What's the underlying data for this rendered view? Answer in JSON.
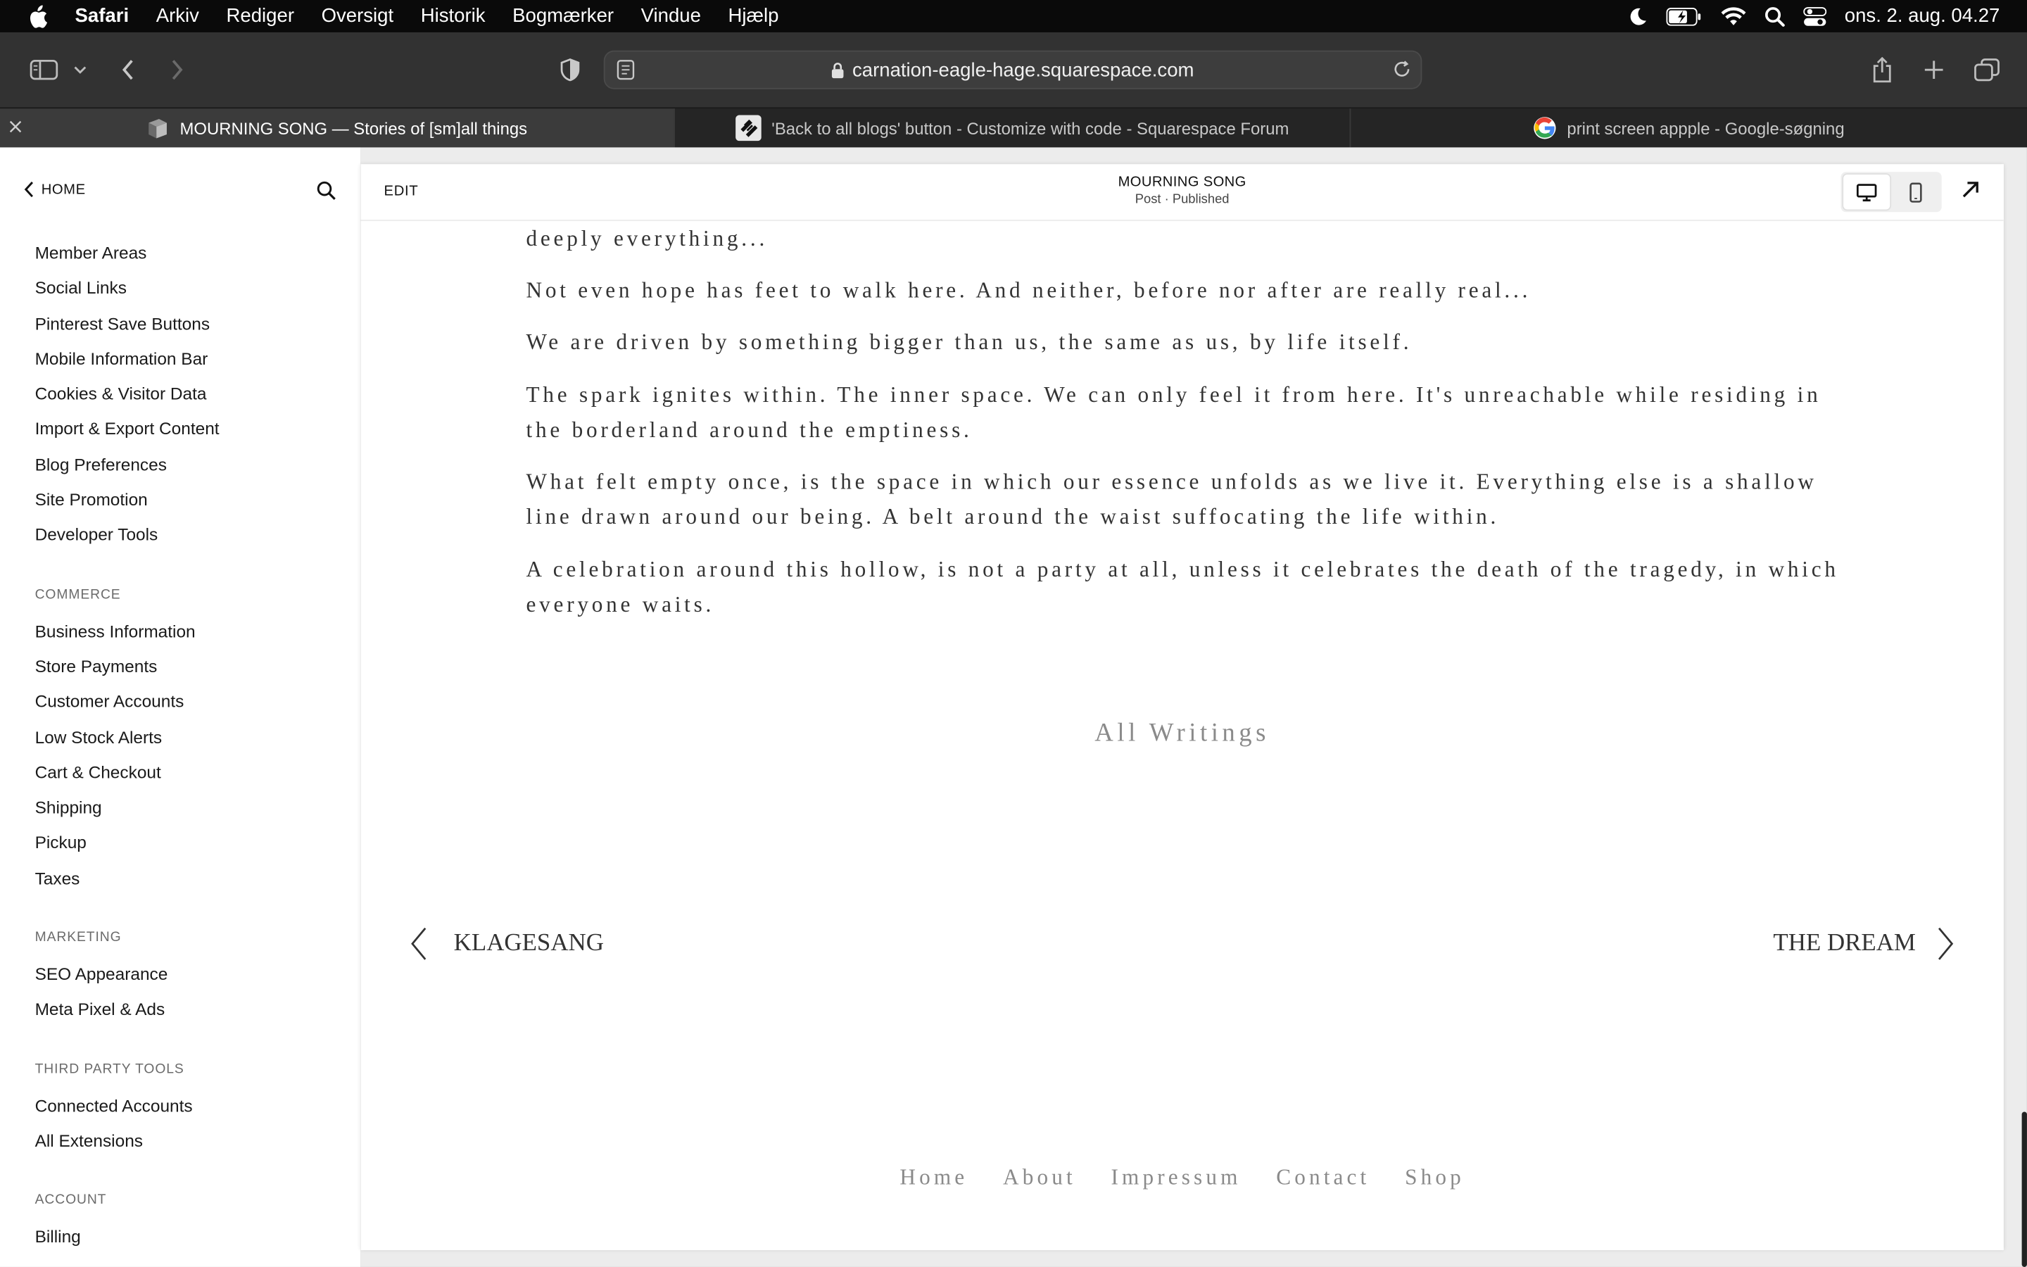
{
  "menubar": {
    "items": [
      "Safari",
      "Arkiv",
      "Rediger",
      "Oversigt",
      "Historik",
      "Bogmærker",
      "Vindue",
      "Hjælp"
    ],
    "clock": "ons. 2. aug. 04.27"
  },
  "toolbar": {
    "url": "carnation-eagle-hage.squarespace.com"
  },
  "tabs": [
    {
      "title": "MOURNING SONG — Stories of [sm]all things",
      "icon": "page-icon"
    },
    {
      "title": "'Back to all blogs' button - Customize with code - Squarespace Forum",
      "icon": "squarespace-icon"
    },
    {
      "title": "print screen appple - Google-søgning",
      "icon": "google-icon"
    }
  ],
  "sidebar": {
    "home_label": "HOME",
    "group1": [
      "Member Areas",
      "Social Links",
      "Pinterest Save Buttons",
      "Mobile Information Bar",
      "Cookies & Visitor Data",
      "Import & Export Content",
      "Blog Preferences",
      "Site Promotion",
      "Developer Tools"
    ],
    "commerce_heading": "COMMERCE",
    "commerce": [
      "Business Information",
      "Store Payments",
      "Customer Accounts",
      "Low Stock Alerts",
      "Cart & Checkout",
      "Shipping",
      "Pickup",
      "Taxes"
    ],
    "marketing_heading": "MARKETING",
    "marketing": [
      "SEO Appearance",
      "Meta Pixel & Ads"
    ],
    "third_party_heading": "THIRD PARTY TOOLS",
    "third_party": [
      "Connected Accounts",
      "All Extensions"
    ],
    "account_heading": "ACCOUNT",
    "account": [
      "Billing"
    ]
  },
  "editor": {
    "edit_label": "EDIT",
    "post_title": "MOURNING SONG",
    "post_status": "Post · Published"
  },
  "post": {
    "paragraphs": [
      "deeply everything...",
      "Not even hope has feet to walk here. And neither, before nor after are really real...",
      "We are driven by something bigger than us, the same as us, by life itself.",
      "The spark ignites within. The inner space. We can only feel it from here. It's unreachable while residing in the borderland around the emptiness.",
      "What felt empty once, is the space in which our essence unfolds as we live it. Everything else is a shallow line drawn around our being. A belt around the waist suffocating the life within.",
      "A celebration around this hollow, is not a party at all, unless it celebrates the death of the tragedy, in which everyone waits."
    ],
    "all_writings": "All Writings",
    "prev_post": "KLAGESANG",
    "next_post": "THE DREAM"
  },
  "footer_nav": [
    "Home",
    "About",
    "Impressum",
    "Contact",
    "Shop"
  ]
}
